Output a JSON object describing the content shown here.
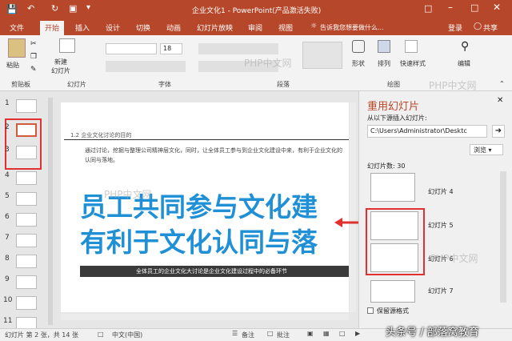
{
  "window": {
    "title": "企业文化1 - PowerPoint(产品激活失败)",
    "login": "登录",
    "share": "共享",
    "tell_me": "告诉我您想要做什么..."
  },
  "tabs": [
    "文件",
    "开始",
    "插入",
    "设计",
    "切换",
    "动画",
    "幻灯片放映",
    "审阅",
    "视图"
  ],
  "ribbon": {
    "paste": "粘贴",
    "new_slide": "新建\n幻灯片",
    "font_size": "18",
    "shapes": "形状",
    "arrange": "排列",
    "quick_styles": "快速样式",
    "editing": "编辑",
    "groups": [
      "剪贴板",
      "幻灯片",
      "字体",
      "段落",
      "绘图"
    ]
  },
  "watermarks": [
    "PHP中文网",
    "PHP中文网",
    "PHP中文网",
    "PHP中文网"
  ],
  "thumbnails": [
    "1",
    "2",
    "3",
    "4",
    "5",
    "6",
    "7",
    "8",
    "9",
    "10",
    "11"
  ],
  "slide": {
    "section": "1.2 企业文化讨论的目的",
    "body": "通过讨论，挖掘与整理公司精神层文化，同时，让全体员工参与到企业文化建设中来，有利于企业文化的认同与落地。",
    "headline1": "员工共同参与文化建",
    "headline2": "有利于文化认同与落",
    "caption": "全体员工的企业文化大讨论是企业文化建设过程中的必备环节"
  },
  "pane": {
    "title": "重用幻灯片",
    "insert_label": "从以下源插入幻灯片:",
    "path": "C:\\Users\\Administrator\\Desktc",
    "browse": "浏览",
    "count": "幻灯片数: 30",
    "items": [
      "幻灯片 4",
      "幻灯片 5",
      "幻灯片 6",
      "幻灯片 7"
    ],
    "keep_format": "保留源格式"
  },
  "status": {
    "slide_info": "幻灯片 第 2 张，共 14 张",
    "language": "中文(中国)",
    "notes": "备注",
    "comments": "批注"
  },
  "overlay": {
    "toutiao": "头条号 / 部落窝教育"
  },
  "colors": {
    "accent": "#b7472a",
    "headline": "#1f8fd6",
    "highlight": "#e03030"
  }
}
